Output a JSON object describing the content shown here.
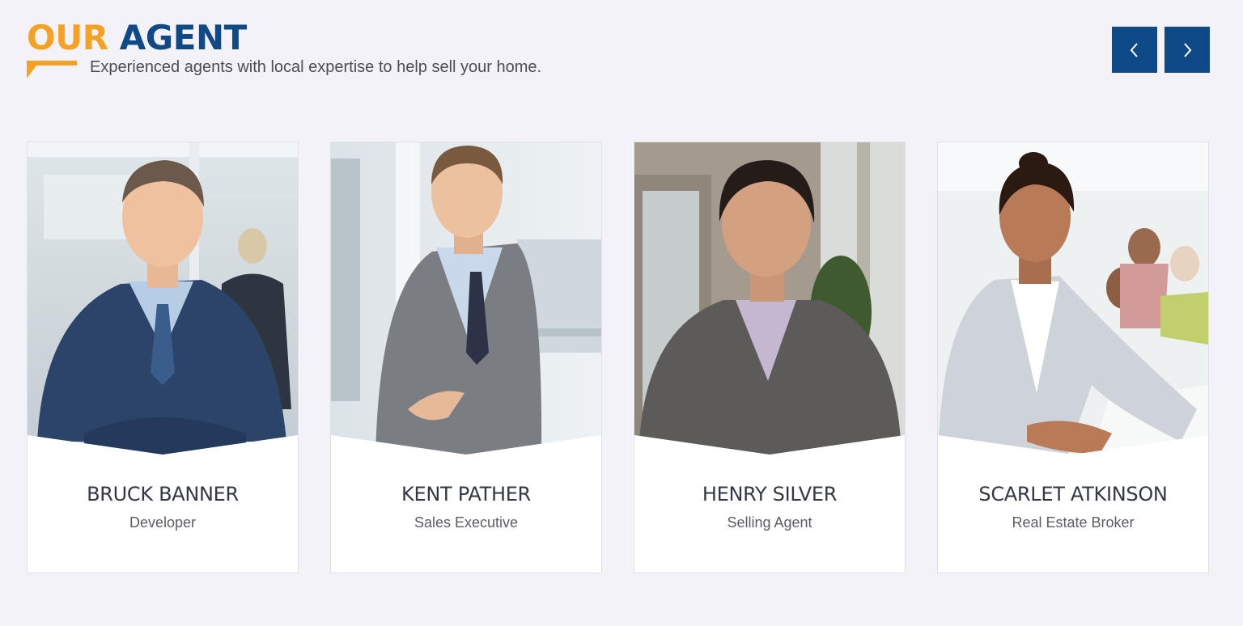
{
  "section": {
    "title_part1": "OUR",
    "title_part2": "AGENT",
    "subtitle": "Experienced agents with local expertise to help sell your home."
  },
  "controls": {
    "prev_icon": "chevron-left-icon",
    "next_icon": "chevron-right-icon"
  },
  "colors": {
    "accent": "#f5a126",
    "brand": "#104a86",
    "background": "#f3f2f8"
  },
  "agents": [
    {
      "name": "BRUCK BANNER",
      "role": "Developer"
    },
    {
      "name": "KENT PATHER",
      "role": "Sales Executive"
    },
    {
      "name": "HENRY SILVER",
      "role": "Selling Agent"
    },
    {
      "name": "SCARLET ATKINSON",
      "role": "Real Estate Broker"
    }
  ]
}
